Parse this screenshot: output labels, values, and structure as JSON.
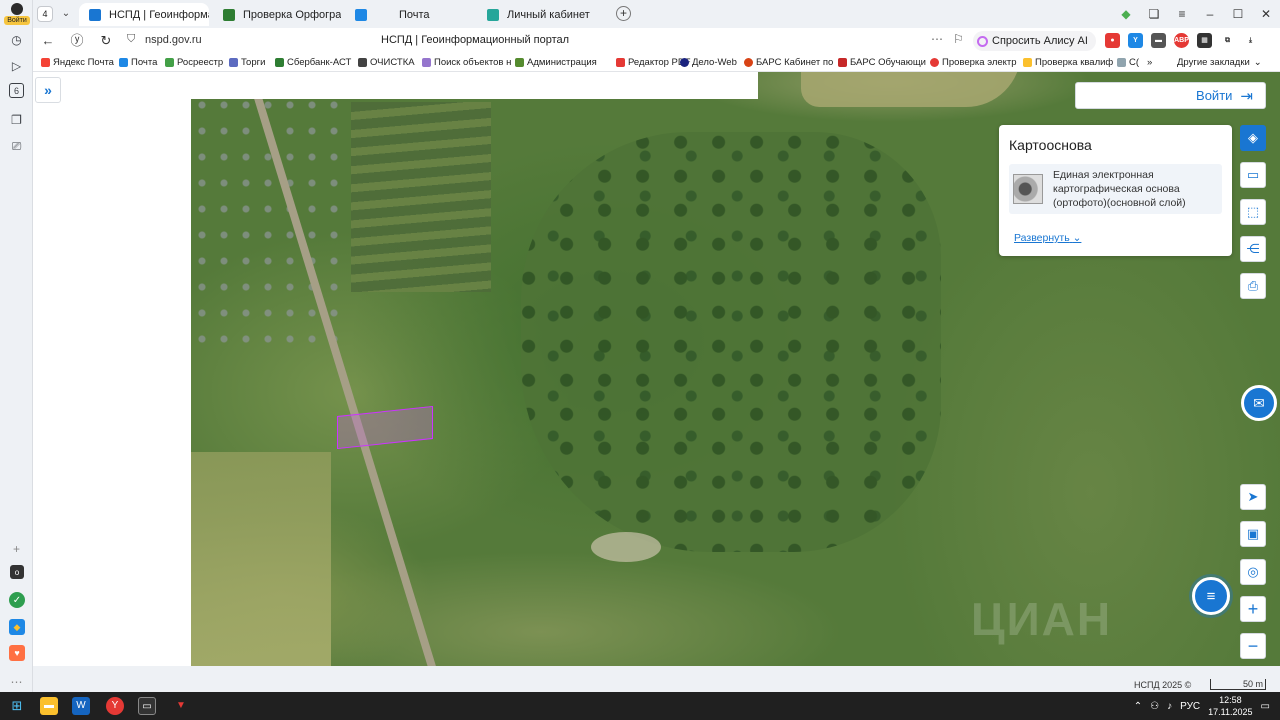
{
  "rail": {
    "avatar_label": "Войти",
    "badge_count": "6"
  },
  "tabs": {
    "count": "4",
    "items": [
      {
        "label": "НСПД | Геоинформаци",
        "close": "✕",
        "favicon_color": "#1976d2"
      },
      {
        "label": "Проверка Орфографии и",
        "favicon_color": "#2e7d32"
      },
      {
        "label": "Почта",
        "favicon_color": "#1e88e5"
      },
      {
        "label": "Личный кабинет",
        "favicon_color": "#26a69a"
      }
    ],
    "new_tab": "+"
  },
  "window_controls": {
    "minimize": "–",
    "maximize": "☐",
    "close": "✕"
  },
  "addressbar": {
    "url": "nspd.gov.ru",
    "page_title": "НСПД | Геоинформационный портал",
    "alice_label": "Спросить Алису AI"
  },
  "bookmarks": [
    {
      "label": "Яндекс Почта",
      "color": "#f44336"
    },
    {
      "label": "Почта",
      "color": "#1e88e5"
    },
    {
      "label": "Росреестр",
      "color": "#43a047"
    },
    {
      "label": "Торги",
      "color": "#5c6bc0"
    },
    {
      "label": "Сбербанк-АСТ",
      "color": "#2e7d32"
    },
    {
      "label": "ОЧИСТКА",
      "color": "#424242"
    },
    {
      "label": "Поиск объектов н",
      "color": "#9575cd"
    },
    {
      "label": "Администрация",
      "color": "#558b2f"
    },
    {
      "label": "Редактор PDF",
      "color": "#e53935"
    },
    {
      "label": "Дело-Web",
      "color": "#1a237e"
    },
    {
      "label": "БАРС Кабинет по",
      "color": "#d84315"
    },
    {
      "label": "БАРС Обучающи",
      "color": "#c62828"
    },
    {
      "label": "Проверка электр",
      "color": "#e53935"
    },
    {
      "label": "Проверка квалиф",
      "color": "#fbc02d"
    },
    {
      "label": "С(",
      "color": "#90a4ae"
    }
  ],
  "bookmarks_more": "»",
  "bookmarks_other": "Другие закладки",
  "page": {
    "expand_icon": "»",
    "login_label": "Войти",
    "login_icon": "⇥",
    "basemap": {
      "title": "Картооснова",
      "layer_name": "Единая электронная картографическая основа (ортофото)(основной слой)",
      "expand_link": "Развернуть",
      "expand_chevron": "⌄"
    },
    "tools": {
      "layers": "◈",
      "ruler": "▭",
      "select": "⬚",
      "share": "⋲",
      "print": "⎙",
      "locate": "➤",
      "screen": "▣",
      "geo": "◎",
      "zoom_in": "+",
      "zoom_out": "−",
      "assistant": "✉",
      "chat": "≡"
    },
    "copyright": "НСПД 2025 ©",
    "scale_label": "50 m"
  },
  "taskbar": {
    "lang": "РУС",
    "time": "12:58",
    "date": "17.11.2025"
  }
}
